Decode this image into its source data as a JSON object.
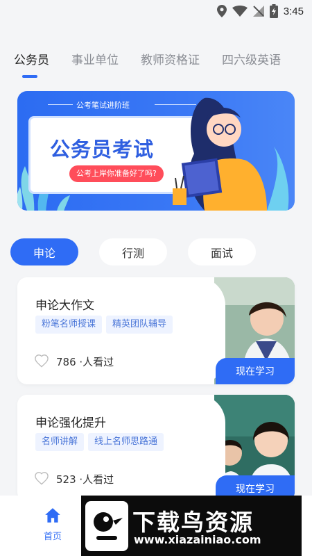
{
  "status_bar": {
    "time": "3:45"
  },
  "tabs": [
    {
      "label": "公务员",
      "active": true
    },
    {
      "label": "事业单位",
      "active": false
    },
    {
      "label": "教师资格证",
      "active": false
    },
    {
      "label": "四六级英语",
      "active": false
    }
  ],
  "banner": {
    "subtitle": "公考笔试进阶班",
    "title": "公务员考试",
    "pill": "公考上岸你准备好了吗?"
  },
  "chips": [
    {
      "label": "申论",
      "active": true
    },
    {
      "label": "行测",
      "active": false
    },
    {
      "label": "面试",
      "active": false
    }
  ],
  "courses": [
    {
      "name": "申论大作文",
      "tags": [
        "粉笔名师授课",
        "精英团队辅导"
      ],
      "views": "786 ·人看过",
      "button": "现在学习"
    },
    {
      "name": "申论强化提升",
      "tags": [
        "名师讲解",
        "线上名师思路通"
      ],
      "views": "523 ·人看过",
      "button": "现在学习"
    }
  ],
  "bottom_nav": {
    "home_label": "首页"
  },
  "watermark": {
    "title": "下载鸟资源",
    "url": "www.xiazainiao.com"
  },
  "colors": {
    "accent": "#2f6cf5",
    "tag_bg": "#eef3ff",
    "tag_text": "#4a76d8",
    "page_bg": "#f4f5f7"
  }
}
